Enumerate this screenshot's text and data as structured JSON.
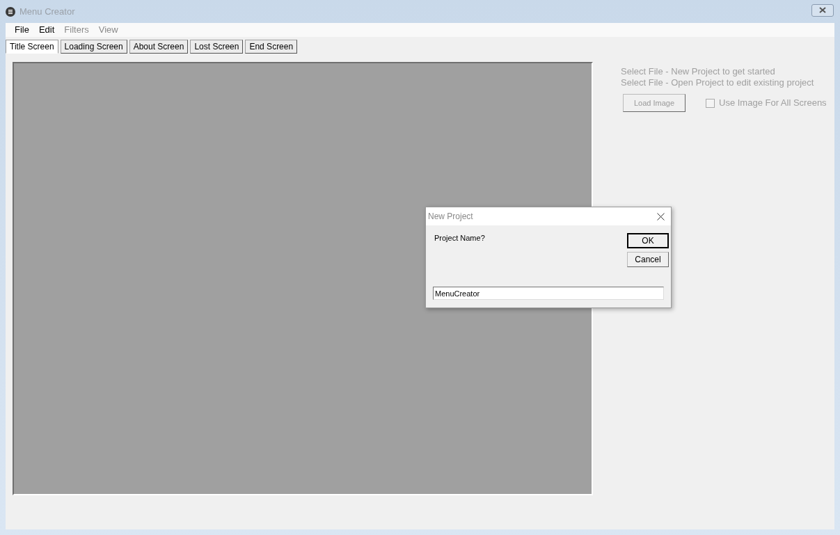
{
  "window": {
    "title": "Menu Creator"
  },
  "menu": [
    {
      "label": "File",
      "disabled": false
    },
    {
      "label": "Edit",
      "disabled": false
    },
    {
      "label": "Filters",
      "disabled": true
    },
    {
      "label": "View",
      "disabled": true
    }
  ],
  "tabs": [
    {
      "label": "Title Screen",
      "selected": true
    },
    {
      "label": "Loading Screen",
      "selected": false
    },
    {
      "label": "About Screen",
      "selected": false
    },
    {
      "label": "Lost Screen",
      "selected": false
    },
    {
      "label": "End Screen",
      "selected": false
    }
  ],
  "hints": [
    "Select File - New Project to get started",
    "Select File - Open Project to edit existing project"
  ],
  "load_image": {
    "label": "Load Image",
    "disabled": true
  },
  "use_for_all": {
    "label": "Use Image For All Screens",
    "checked": false,
    "disabled": true
  },
  "dialog": {
    "title": "New Project",
    "prompt": "Project Name?",
    "value": "MenuCreator",
    "buttons": [
      {
        "label": "OK",
        "default": true
      },
      {
        "label": "Cancel",
        "default": false
      }
    ]
  }
}
